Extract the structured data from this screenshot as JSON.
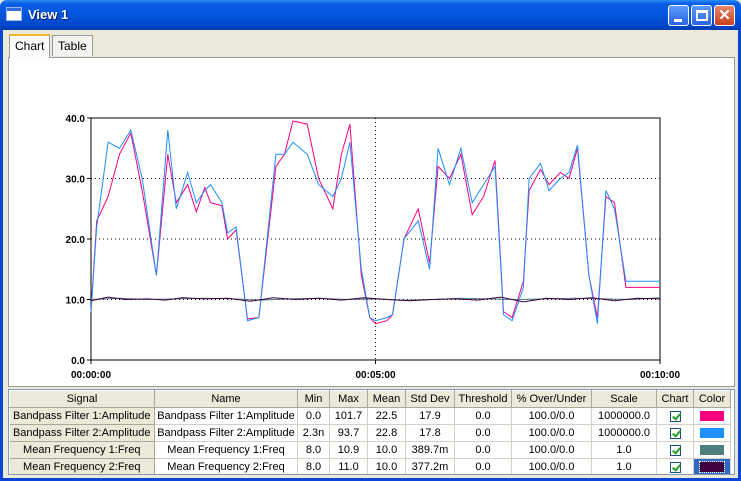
{
  "window": {
    "title": "View 1"
  },
  "tabs": [
    {
      "label": "Chart"
    },
    {
      "label": "Table"
    }
  ],
  "chart_data": {
    "type": "line",
    "title": "",
    "xlabel": "",
    "ylabel": "",
    "ylim": [
      0,
      40
    ],
    "yticks": [
      "0.0",
      "10.0",
      "20.0",
      "30.0",
      "40.0"
    ],
    "xticks": [
      "00:00:00",
      "00:05:00",
      "00:10:00"
    ],
    "xlim_minutes": [
      0,
      10
    ],
    "grid": true,
    "cursor_minutes": 5,
    "series": [
      {
        "name": "Bandpass Filter 1:Amplitude",
        "color": "#ff0080",
        "x": [
          0,
          0.1,
          0.3,
          0.5,
          0.7,
          0.9,
          1.15,
          1.35,
          1.5,
          1.7,
          1.85,
          2.0,
          2.1,
          2.3,
          2.4,
          2.55,
          2.75,
          2.95,
          3.25,
          3.4,
          3.55,
          3.8,
          4.0,
          4.25,
          4.4,
          4.55,
          4.75,
          4.9,
          5.0,
          5.2,
          5.3,
          5.5,
          5.75,
          5.95,
          6.1,
          6.3,
          6.5,
          6.7,
          6.9,
          7.1,
          7.25,
          7.4,
          7.6,
          7.7,
          7.9,
          8.05,
          8.25,
          8.4,
          8.55,
          8.75,
          8.9,
          9.05,
          9.2,
          9.4,
          9.55,
          9.7,
          9.85,
          10.0
        ],
        "y": [
          8,
          23,
          27,
          34,
          37.5,
          28,
          14,
          34,
          26,
          29,
          24.5,
          28.5,
          26,
          25.5,
          20,
          21.5,
          6.8,
          7,
          32,
          34,
          39.5,
          39,
          30,
          25,
          34,
          39,
          14,
          7,
          6,
          6.5,
          7.5,
          20,
          25,
          16,
          32,
          30,
          34,
          24,
          27,
          33,
          8,
          7,
          13,
          28,
          31.5,
          29,
          31,
          30,
          35,
          14,
          7,
          27,
          26,
          12,
          12,
          12,
          12,
          12
        ]
      },
      {
        "name": "Bandpass Filter 2:Amplitude",
        "color": "#1e90ff",
        "x": [
          0,
          0.1,
          0.3,
          0.5,
          0.7,
          0.9,
          1.15,
          1.35,
          1.5,
          1.7,
          1.85,
          2.0,
          2.1,
          2.3,
          2.4,
          2.55,
          2.75,
          2.95,
          3.25,
          3.4,
          3.55,
          3.8,
          4.0,
          4.25,
          4.4,
          4.55,
          4.75,
          4.9,
          5.0,
          5.2,
          5.3,
          5.5,
          5.75,
          5.95,
          6.1,
          6.3,
          6.5,
          6.7,
          6.9,
          7.1,
          7.25,
          7.4,
          7.6,
          7.7,
          7.9,
          8.05,
          8.25,
          8.4,
          8.55,
          8.75,
          8.9,
          9.05,
          9.2,
          9.4,
          9.55,
          9.7,
          9.85,
          10.0
        ],
        "y": [
          8,
          22,
          36,
          35,
          38,
          30,
          14,
          38,
          25,
          31,
          26,
          28,
          29,
          26,
          21,
          22,
          6.5,
          7,
          34,
          34,
          36,
          34,
          29,
          27,
          30,
          36,
          15,
          7,
          6.5,
          7,
          7.5,
          20,
          23,
          15,
          35,
          29,
          35,
          26,
          29,
          32,
          7.5,
          6.5,
          12,
          30,
          32.5,
          28,
          30,
          31,
          35.5,
          14,
          6,
          28,
          25,
          13,
          13,
          13,
          13,
          13
        ]
      },
      {
        "name": "Mean Frequency 1:Freq",
        "color": "#4e7f7f",
        "x": [
          0,
          0.5,
          1,
          1.5,
          2,
          2.5,
          3,
          3.5,
          4,
          4.5,
          5,
          5.5,
          6,
          6.5,
          7,
          7.5,
          8,
          8.5,
          9,
          9.5,
          10
        ],
        "y": [
          10,
          10.2,
          10,
          10.1,
          10.2,
          10.1,
          9.9,
          10.1,
          10.2,
          10,
          10.1,
          9.9,
          10,
          10.2,
          10.1,
          10,
          10.1,
          10.2,
          10.1,
          10,
          10.3
        ]
      },
      {
        "name": "Mean Frequency 2:Freq",
        "color": "#400040",
        "x": [
          0,
          0.3,
          0.6,
          1,
          1.3,
          1.6,
          2,
          2.4,
          2.8,
          3.2,
          3.6,
          4,
          4.4,
          4.8,
          5.2,
          5.6,
          6,
          6.4,
          6.8,
          7.2,
          7.6,
          8,
          8.4,
          8.8,
          9.2,
          9.6,
          10
        ],
        "y": [
          9.8,
          10.4,
          10,
          10.1,
          9.9,
          10.3,
          10.1,
          10.2,
          9.7,
          10.3,
          10,
          10.2,
          9.9,
          10.3,
          10,
          9.8,
          10,
          10.1,
          9.9,
          10.4,
          9.6,
          10.2,
          10,
          10.3,
          9.8,
          10.2,
          10.1
        ]
      }
    ]
  },
  "table": {
    "headers": [
      "Signal",
      "Name",
      "Min",
      "Max",
      "Mean",
      "Std Dev",
      "Threshold",
      "% Over/Under",
      "Scale",
      "Chart",
      "Color"
    ],
    "rows": [
      {
        "signal": "Bandpass Filter 1:Amplitude",
        "name": "Bandpass Filter 1:Amplitude",
        "min": "0.0",
        "max": "101.7",
        "mean": "22.5",
        "std": "17.9",
        "threshold": "0.0",
        "over": "100.0/0.0",
        "scale": "1000000.0",
        "chart": true,
        "color": "#ff0080",
        "selected": false
      },
      {
        "signal": "Bandpass Filter 2:Amplitude",
        "name": "Bandpass Filter 2:Amplitude",
        "min": "2.3n",
        "max": "93.7",
        "mean": "22.8",
        "std": "17.8",
        "threshold": "0.0",
        "over": "100.0/0.0",
        "scale": "1000000.0",
        "chart": true,
        "color": "#1e90ff",
        "selected": false
      },
      {
        "signal": "Mean Frequency 1:Freq",
        "name": "Mean Frequency 1:Freq",
        "min": "8.0",
        "max": "10.9",
        "mean": "10.0",
        "std": "389.7m",
        "threshold": "0.0",
        "over": "100.0/0.0",
        "scale": "1.0",
        "chart": true,
        "color": "#4e7f7f",
        "selected": false
      },
      {
        "signal": "Mean Frequency 2:Freq",
        "name": "Mean Frequency 2:Freq",
        "min": "8.0",
        "max": "11.0",
        "mean": "10.0",
        "std": "377.2m",
        "threshold": "0.0",
        "over": "100.0/0.0",
        "scale": "1.0",
        "chart": true,
        "color": "#400040",
        "selected": true
      }
    ]
  }
}
